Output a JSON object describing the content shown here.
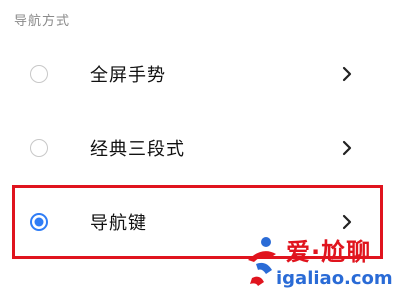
{
  "section": {
    "title": "导航方式"
  },
  "options": [
    {
      "label": "全屏手势",
      "selected": false,
      "radio_icon": "radio-unchecked-icon",
      "arrow_icon": "chevron-right-icon"
    },
    {
      "label": "经典三段式",
      "selected": false,
      "radio_icon": "radio-unchecked-icon",
      "arrow_icon": "chevron-right-icon"
    },
    {
      "label": "导航键",
      "selected": true,
      "radio_icon": "radio-checked-icon",
      "arrow_icon": "chevron-right-icon"
    }
  ],
  "watermark": {
    "brand": "爱·尬聊",
    "url": "igaliao.com"
  },
  "colors": {
    "accent": "#2f7df6",
    "highlight": "#e0141e",
    "watermark_red": "#e0141e",
    "watermark_blue": "#2a6bd6"
  }
}
